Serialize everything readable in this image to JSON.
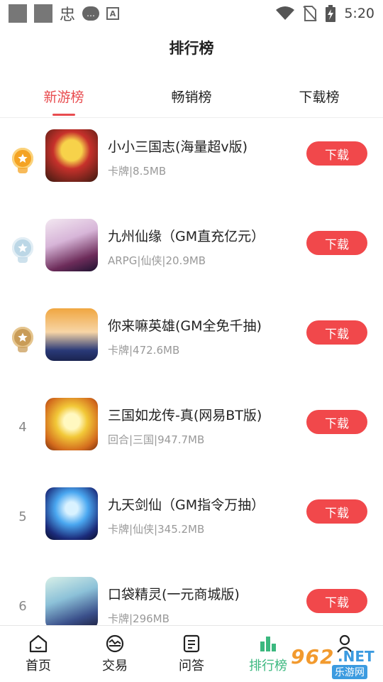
{
  "status_bar": {
    "time": "5:20",
    "glyph": "忠",
    "bubble": "…",
    "a_label": "A",
    "icons": [
      "app-square-icon",
      "app-square-icon",
      "wechat-bubble-icon",
      "font-a-icon",
      "wifi-icon",
      "no-sim-icon",
      "battery-charging-icon"
    ]
  },
  "header": {
    "title": "排行榜"
  },
  "tabs": [
    {
      "label": "新游榜",
      "active": true
    },
    {
      "label": "畅销榜",
      "active": false
    },
    {
      "label": "下载榜",
      "active": false
    }
  ],
  "apps": [
    {
      "rank": "1",
      "medal": "gold",
      "name": "小小三国志(海量超v版)",
      "meta": "卡牌|8.5MB",
      "button": "下载",
      "icon_tag": ""
    },
    {
      "rank": "2",
      "medal": "silver",
      "name": "九州仙缘（GM直充亿元）",
      "meta": "ARPG|仙侠|20.9MB",
      "button": "下载",
      "icon_tag": ""
    },
    {
      "rank": "3",
      "medal": "bronze",
      "name": "你来嘛英雄(GM全免千抽)",
      "meta": "卡牌|472.6MB",
      "button": "下载",
      "icon_tag": ""
    },
    {
      "rank": "4",
      "medal": "",
      "name": "三国如龙传-真(网易BT版)",
      "meta": "回合|三国|947.7MB",
      "button": "下载",
      "icon_tag": ""
    },
    {
      "rank": "5",
      "medal": "",
      "name": "九天剑仙（GM指令万抽）",
      "meta": "卡牌|仙侠|345.2MB",
      "button": "下载",
      "icon_tag": ""
    },
    {
      "rank": "6",
      "medal": "",
      "name": "口袋精灵(一元商城版)",
      "meta": "卡牌|296MB",
      "button": "下载",
      "icon_tag": ""
    }
  ],
  "bottom_nav": [
    {
      "label": "首页",
      "icon": "home-icon",
      "active": false
    },
    {
      "label": "交易",
      "icon": "trade-icon",
      "active": false
    },
    {
      "label": "问答",
      "icon": "qa-icon",
      "active": false
    },
    {
      "label": "排行榜",
      "icon": "ranking-icon",
      "active": true
    },
    {
      "label": "",
      "icon": "user-icon",
      "active": false
    }
  ],
  "watermark": {
    "number": "962",
    "suffix": ".NET",
    "sub": "乐游网"
  },
  "colors": {
    "accent": "#e84c4f",
    "button": "#f1484b",
    "nav_active": "#3bb87f"
  }
}
